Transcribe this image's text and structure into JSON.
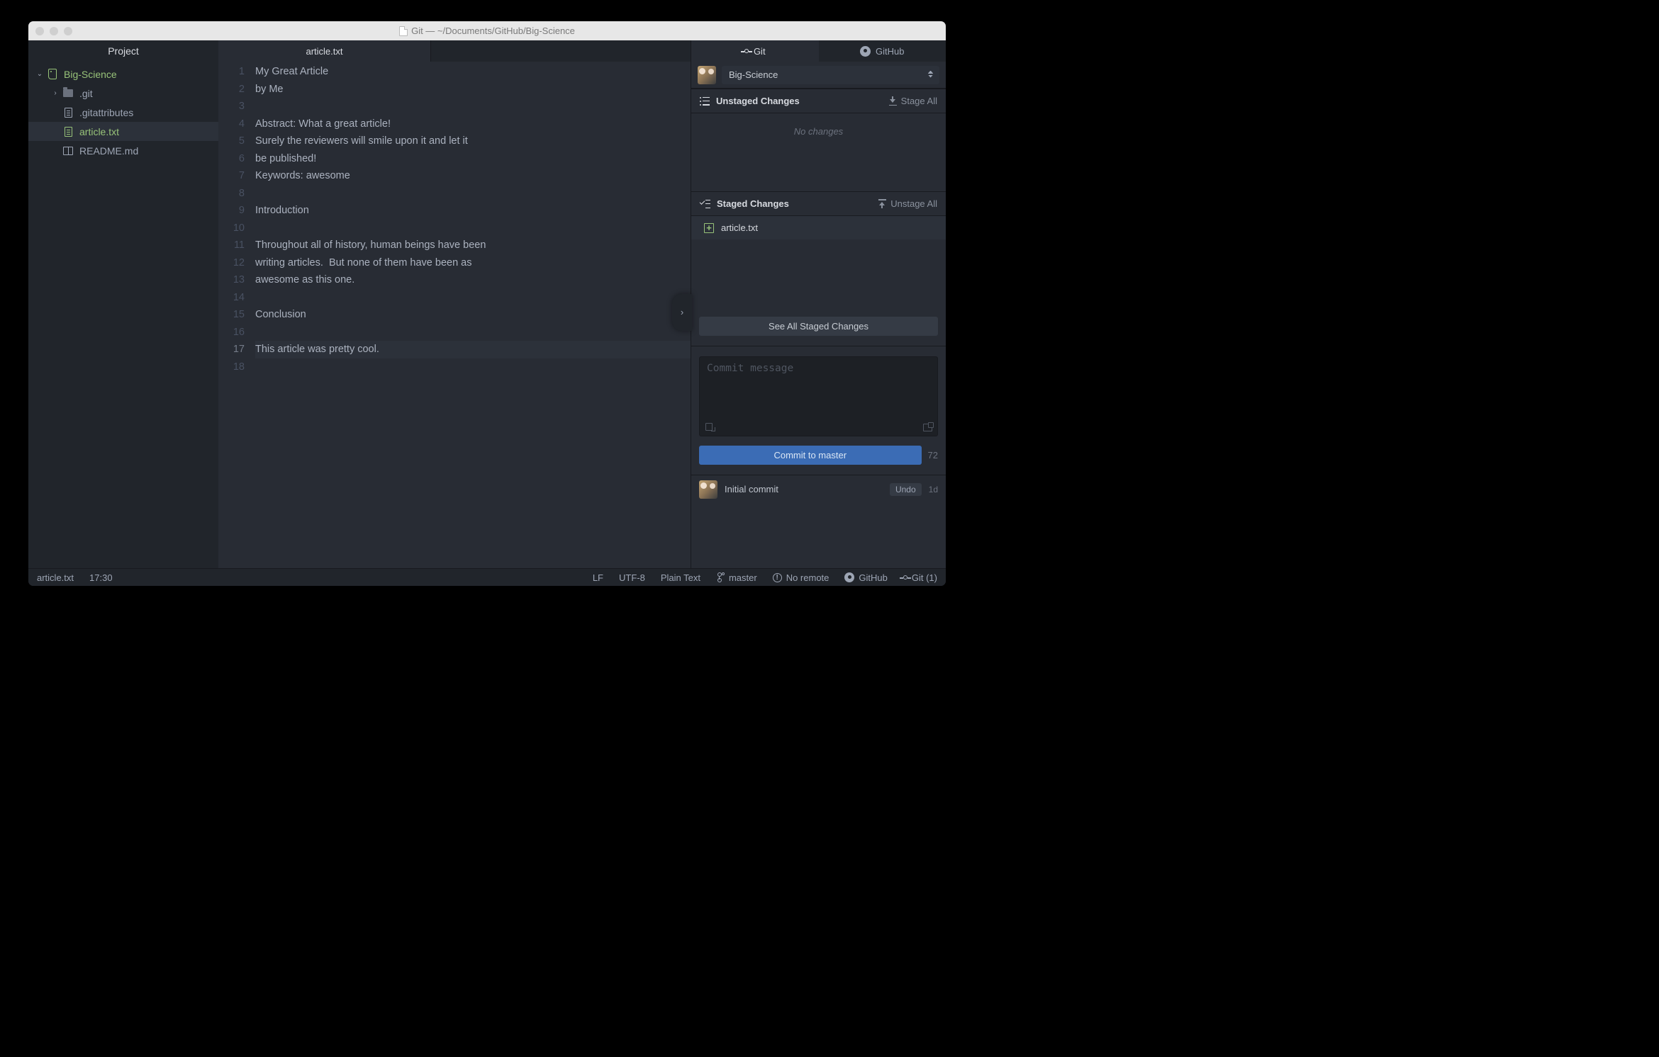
{
  "window": {
    "title": "Git — ~/Documents/GitHub/Big-Science"
  },
  "tree": {
    "header": "Project",
    "root": "Big-Science",
    "items": [
      {
        "name": ".git"
      },
      {
        "name": ".gitattributes"
      },
      {
        "name": "article.txt"
      },
      {
        "name": "README.md"
      }
    ]
  },
  "editor": {
    "tab": "article.txt",
    "lines": [
      "My Great Article",
      "by Me",
      "",
      "Abstract: What a great article!",
      "Surely the reviewers will smile upon it and let it",
      "be published!",
      "Keywords: awesome",
      "",
      "Introduction",
      "",
      "Throughout all of history, human beings have been",
      "writing articles.  But none of them have been as",
      "awesome as this one.",
      "",
      "Conclusion",
      "",
      "This article was pretty cool.",
      ""
    ],
    "cursor_line": 17
  },
  "panel": {
    "tabs": {
      "git": "Git",
      "github": "GitHub"
    },
    "project": "Big-Science",
    "unstaged": {
      "label": "Unstaged Changes",
      "button": "Stage All",
      "empty": "No changes"
    },
    "staged": {
      "label": "Staged Changes",
      "button": "Unstage All",
      "files": [
        "article.txt"
      ]
    },
    "see_all": "See All Staged Changes",
    "commit": {
      "placeholder": "Commit message",
      "button": "Commit to master",
      "remaining": "72"
    },
    "history": {
      "message": "Initial commit",
      "undo": "Undo",
      "age": "1d"
    }
  },
  "status": {
    "file": "article.txt",
    "cursor": "17:30",
    "eol": "LF",
    "encoding": "UTF-8",
    "grammar": "Plain Text",
    "branch": "master",
    "remote": "No remote",
    "github": "GitHub",
    "git": "Git (1)"
  }
}
